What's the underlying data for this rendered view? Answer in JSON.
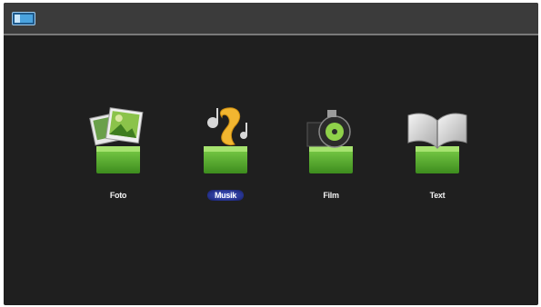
{
  "topbar": {
    "source_icon": "input-source-icon"
  },
  "menu": {
    "items": [
      {
        "label": "Foto",
        "icon": "photo-icon",
        "selected": false
      },
      {
        "label": "Musik",
        "icon": "music-icon",
        "selected": true
      },
      {
        "label": "Film",
        "icon": "film-reel-icon",
        "selected": false
      },
      {
        "label": "Text",
        "icon": "book-icon",
        "selected": false
      }
    ]
  },
  "colors": {
    "background": "#1f1f1f",
    "topbar": "#3b3b3b",
    "folder_green": "#5cb531",
    "selection": "#3a4cb8",
    "label": "#f2f2f2"
  }
}
